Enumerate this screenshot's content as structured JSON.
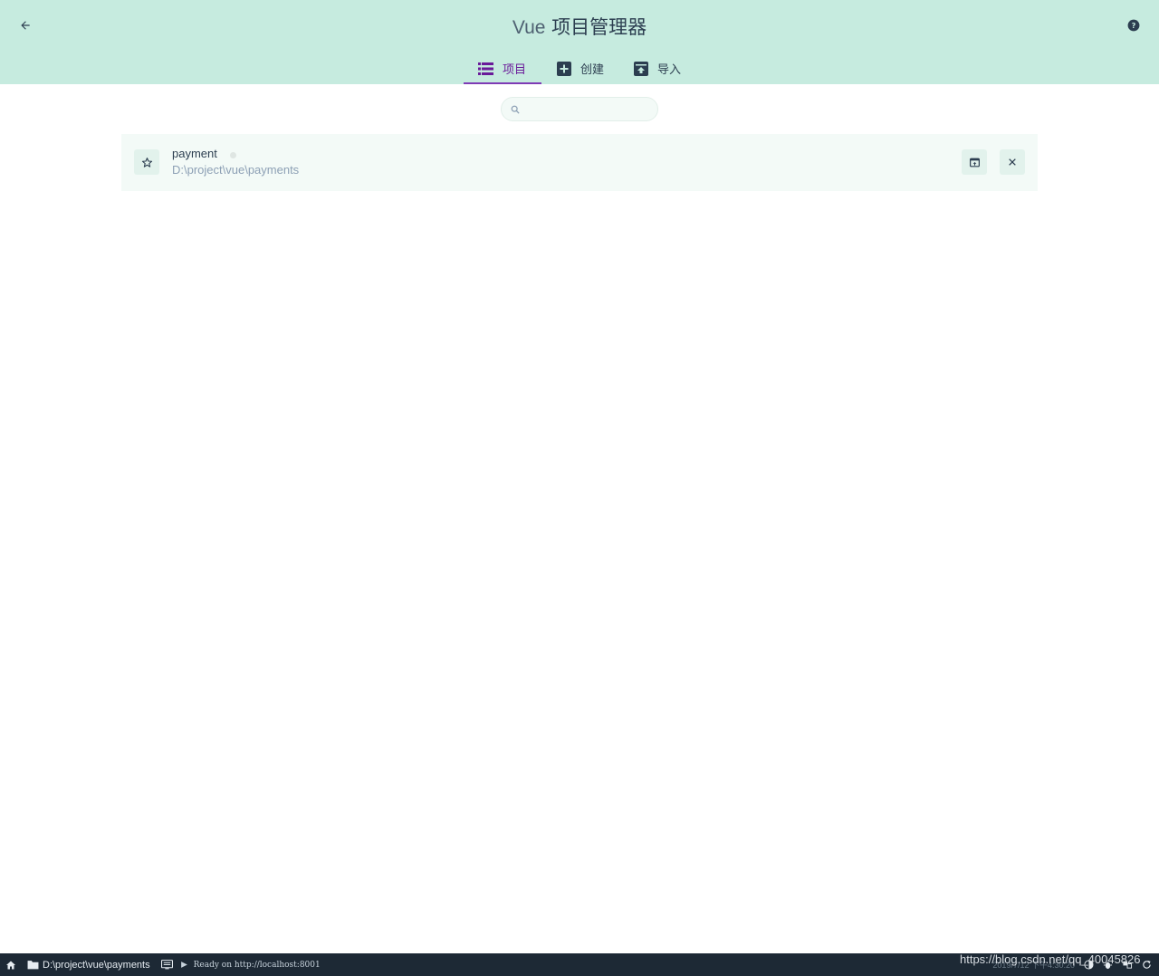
{
  "header": {
    "title_prefix": "Vue",
    "title_main": "项目管理器",
    "back_icon": "arrow-left-icon",
    "help_icon": "help-circle-icon"
  },
  "tabs": [
    {
      "label": "项目",
      "icon": "list-icon",
      "active": true
    },
    {
      "label": "创建",
      "icon": "add-box-icon",
      "active": false
    },
    {
      "label": "导入",
      "icon": "unarchive-icon",
      "active": false
    }
  ],
  "search": {
    "placeholder": "",
    "value": ""
  },
  "projects": [
    {
      "name": "payment",
      "path": "D:\\project\\vue\\payments",
      "favorite": false
    }
  ],
  "statusbar": {
    "path": "D:\\project\\vue\\payments",
    "log": "Ready on http://localhost:8001",
    "date": "2019/7/12  下午4:30:20"
  },
  "watermark": "https://blog.csdn.net/qq_40045826",
  "colors": {
    "header_bg": "#c6ebdf",
    "accent": "#6a1b9a",
    "row_bg": "#f3faf7",
    "statusbar_bg": "#1d2935"
  }
}
